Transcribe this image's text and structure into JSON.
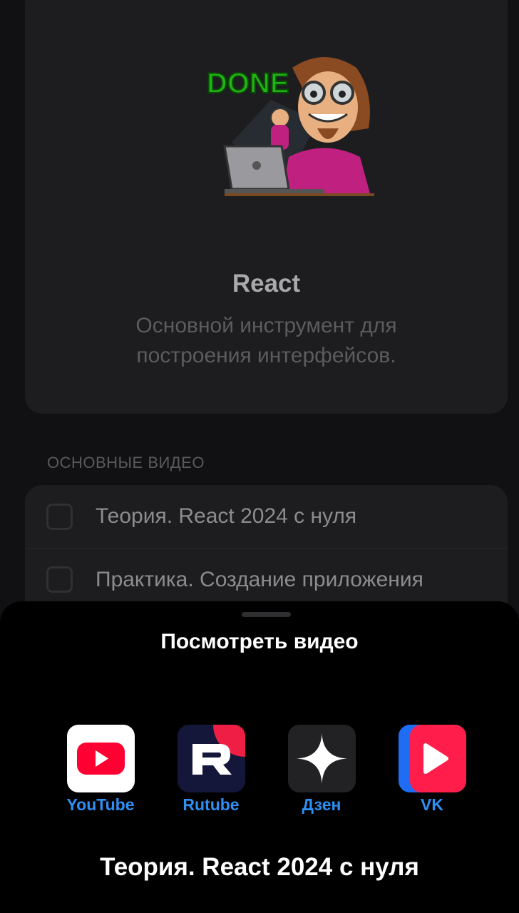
{
  "course": {
    "title": "React",
    "description": "Основной инструмент для построения интерфейсов.",
    "sticker_text": "DONE"
  },
  "section_label": "ОСНОВНЫЕ ВИДЕО",
  "videos": [
    {
      "title": "Теория. React 2024 с нуля"
    },
    {
      "title": "Практика. Создание приложения"
    }
  ],
  "sheet": {
    "title": "Посмотреть видео",
    "video_title": "Теория. React 2024 с нуля",
    "services": [
      {
        "label": "YouTube",
        "icon": "youtube-icon"
      },
      {
        "label": "Rutube",
        "icon": "rutube-icon"
      },
      {
        "label": "Дзен",
        "icon": "dzen-icon"
      },
      {
        "label": "VK",
        "icon": "vk-icon"
      }
    ]
  },
  "colors": {
    "accent": "#2e8ff5",
    "youtube_red": "#ff0033",
    "rutube_navy": "#14163a",
    "rutube_red": "#ef1e45",
    "vk_red": "#ff1e4b",
    "vk_blue": "#1f6cf5"
  }
}
